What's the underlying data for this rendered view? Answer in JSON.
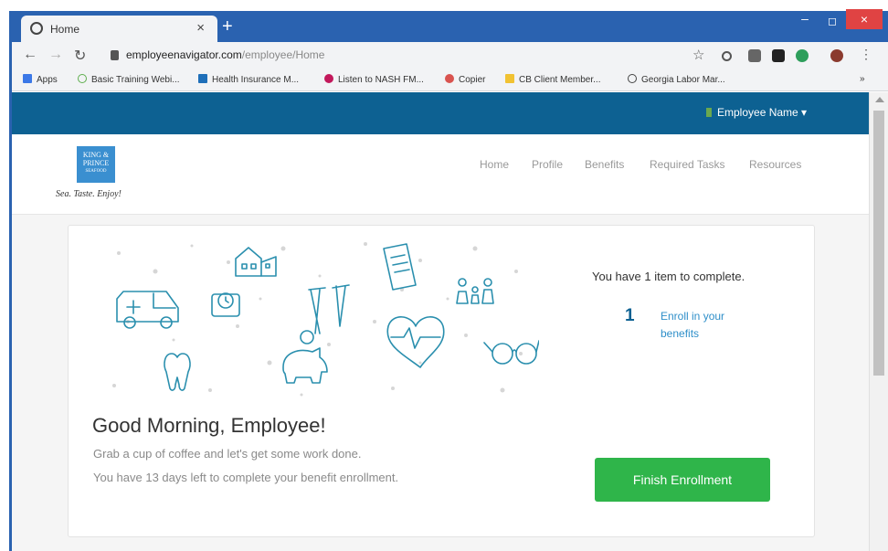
{
  "browser": {
    "tab_title": "Home",
    "tab_close": "×",
    "new_tab": "+",
    "window_min": "–",
    "window_max": "◻",
    "window_close": "×",
    "url_domain": "employeenavigator.com",
    "url_path": "/employee/Home",
    "bookmarks": [
      {
        "label": "Apps",
        "color": "#3b78e7"
      },
      {
        "label": "Basic Training Webi...",
        "color": "#5fae4e"
      },
      {
        "label": "Health Insurance M...",
        "color": "#1e6fb9"
      },
      {
        "label": "Listen to NASH FM...",
        "color": "#c2185b"
      },
      {
        "label": "Copier",
        "color": "#d9534f"
      },
      {
        "label": "CB Client Member...",
        "color": "#f1c232"
      },
      {
        "label": "Georgia Labor Mar...",
        "color": "#444444"
      }
    ],
    "bookmarks_overflow": "»"
  },
  "topnav": {
    "user_menu": "Employee Name ▾"
  },
  "header": {
    "logo_lines": [
      "KING &",
      "PRINCE",
      "SEAFOOD"
    ],
    "logo_tagline": "Sea. Taste. Enjoy!",
    "menu": [
      "Home",
      "Profile",
      "Benefits",
      "Required Tasks",
      "Resources"
    ]
  },
  "card": {
    "greeting": "Good Morning, Employee!",
    "sub1": "Grab a cup of coffee and let's get some work done.",
    "sub2": "You have 13 days left to complete your benefit enrollment.",
    "tasks_heading": "You have 1 item to complete.",
    "task_number": "1",
    "task_label": "Enroll in your benefits",
    "finish_button": "Finish Enrollment"
  },
  "icons": {
    "illustration": [
      "ambulance-icon",
      "building-icon",
      "clock-icon",
      "document-icon",
      "crutches-icon",
      "family-icon",
      "tooth-icon",
      "piggy-bank-icon",
      "heart-icon",
      "glasses-icon"
    ]
  },
  "colors": {
    "brand_blue": "#0d6192",
    "accent_green": "#2fb54a",
    "link_blue": "#2f8fc9",
    "illus_teal": "#2a8fae"
  }
}
